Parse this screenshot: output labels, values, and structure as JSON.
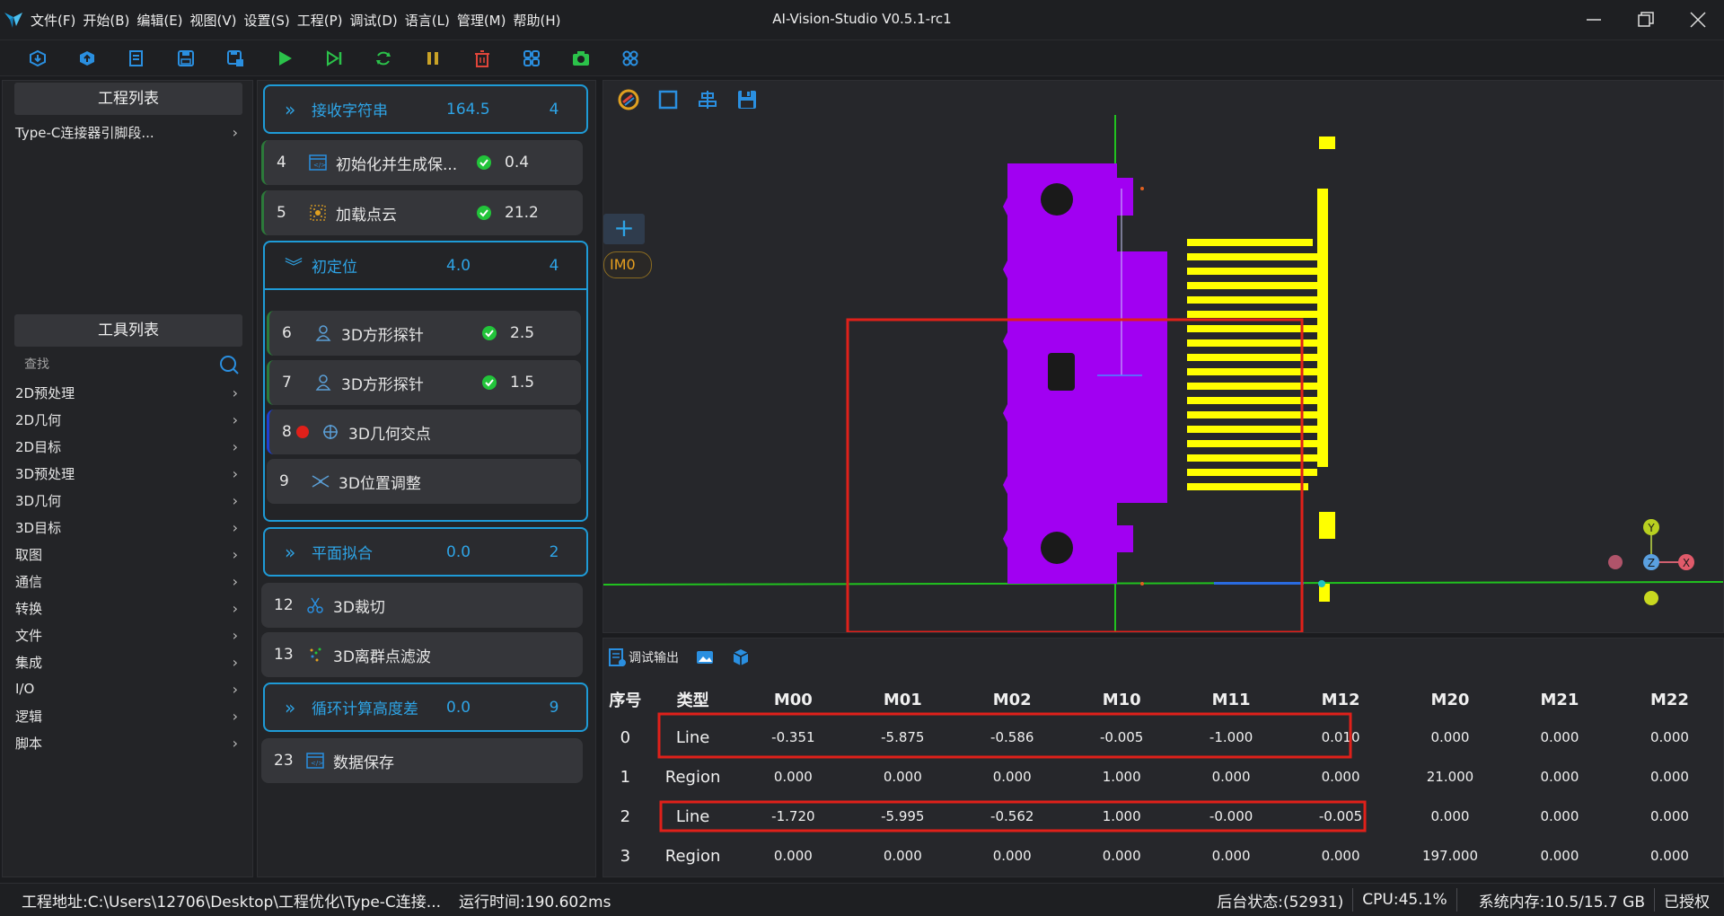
{
  "app": {
    "title": "AI-Vision-Studio V0.5.1-rc1"
  },
  "menu": [
    "文件(F)",
    "开始(B)",
    "编辑(E)",
    "视图(V)",
    "设置(S)",
    "工程(P)",
    "调试(D)",
    "语言(L)",
    "管理(M)",
    "帮助(H)"
  ],
  "toolbar": [
    "import-icon",
    "export-icon",
    "new-project-icon",
    "save-icon",
    "save-as-icon",
    "run-icon",
    "step-run-icon",
    "loop-run-icon",
    "pause-icon",
    "delete-icon",
    "tool-grid-icon",
    "camera-icon",
    "layout-grid-icon"
  ],
  "left": {
    "project_header": "工程列表",
    "projects": [
      "Type-C连接器引脚段..."
    ],
    "tools_header": "工具列表",
    "search_placeholder": "查找",
    "categories": [
      "2D预处理",
      "2D几何",
      "2D目标",
      "3D预处理",
      "3D几何",
      "3D目标",
      "取图",
      "通信",
      "转换",
      "文件",
      "集成",
      "I/O",
      "逻辑",
      "脚本"
    ]
  },
  "flow": {
    "group_receive": {
      "name": "接收字符串",
      "time": "164.5",
      "count": "4"
    },
    "node4": {
      "idx": "4",
      "name": "初始化并生成保...",
      "time": "0.4",
      "status": "ok"
    },
    "node5": {
      "idx": "5",
      "name": "加载点云",
      "time": "21.2",
      "status": "ok"
    },
    "group_locate": {
      "name": "初定位",
      "time": "4.0",
      "count": "4"
    },
    "node6": {
      "idx": "6",
      "name": "3D方形探针",
      "time": "2.5",
      "status": "ok"
    },
    "node7": {
      "idx": "7",
      "name": "3D方形探针",
      "time": "1.5",
      "status": "ok"
    },
    "node8": {
      "idx": "8",
      "name": "3D几何交点",
      "status": "error"
    },
    "node9": {
      "idx": "9",
      "name": "3D位置调整"
    },
    "group_plane": {
      "name": "平面拟合",
      "time": "0.0",
      "count": "2"
    },
    "node12": {
      "idx": "12",
      "name": "3D裁切"
    },
    "node13": {
      "idx": "13",
      "name": "3D离群点滤波"
    },
    "group_loop": {
      "name": "循环计算高度差",
      "time": "0.0",
      "count": "9"
    },
    "node23": {
      "idx": "23",
      "name": "数据保存"
    }
  },
  "viewer": {
    "image_tag": "IM0",
    "axes": {
      "x": "X",
      "y": "Y",
      "z": "Z"
    },
    "colors": {
      "body": "#a100f2",
      "pins": "#ffff00",
      "axis_line": "#21c21f",
      "roi": "#e0201a"
    }
  },
  "output": {
    "tab_label": "调试输出",
    "columns": [
      "序号",
      "类型",
      "M00",
      "M01",
      "M02",
      "M10",
      "M11",
      "M12",
      "M20",
      "M21",
      "M22"
    ],
    "rows": [
      [
        "0",
        "Line",
        "-0.351",
        "-5.875",
        "-0.586",
        "-0.005",
        "-1.000",
        "0.010",
        "0.000",
        "0.000",
        "0.000"
      ],
      [
        "1",
        "Region",
        "0.000",
        "0.000",
        "0.000",
        "1.000",
        "0.000",
        "0.000",
        "21.000",
        "0.000",
        "0.000"
      ],
      [
        "2",
        "Line",
        "-1.720",
        "-5.995",
        "-0.562",
        "1.000",
        "-0.000",
        "-0.005",
        "0.000",
        "0.000",
        "0.000"
      ],
      [
        "3",
        "Region",
        "0.000",
        "0.000",
        "0.000",
        "0.000",
        "0.000",
        "0.000",
        "197.000",
        "0.000",
        "0.000"
      ]
    ]
  },
  "status": {
    "project_path": "工程地址:C:\\Users\\12706\\Desktop\\工程优化\\Type-C连接...",
    "run_time": "运行时间:190.602ms",
    "backend": "后台状态:(52931)",
    "cpu": "CPU:45.1%",
    "memory": "系统内存:10.5/15.7 GB",
    "license": "已授权"
  }
}
